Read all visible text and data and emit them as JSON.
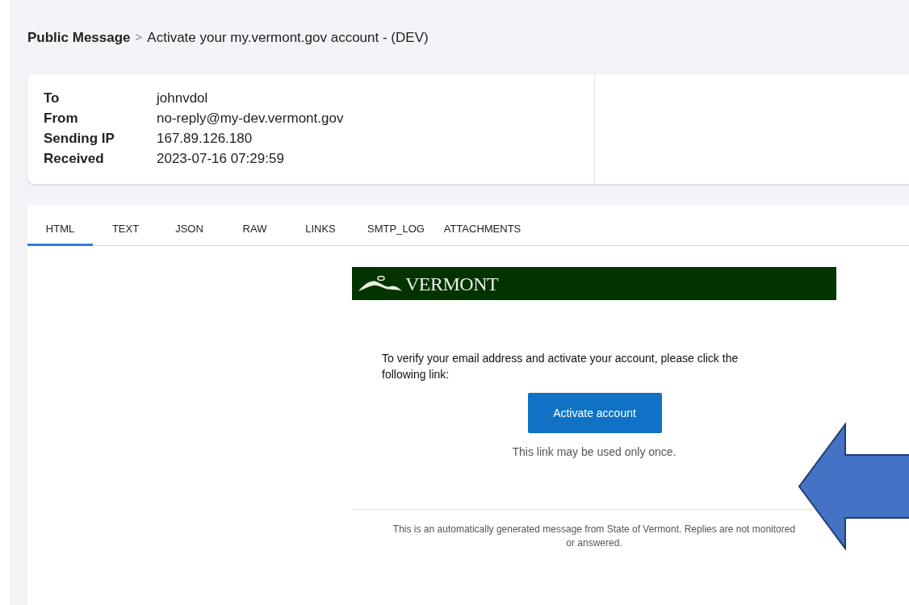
{
  "breadcrumb": {
    "root": "Public Message",
    "separator": ">",
    "current": "Activate your my.vermont.gov account - (DEV)"
  },
  "headers": [
    {
      "label": "To",
      "value": "johnvdol"
    },
    {
      "label": "From",
      "value": "no-reply@my-dev.vermont.gov"
    },
    {
      "label": "Sending IP",
      "value": "167.89.126.180"
    },
    {
      "label": "Received",
      "value": "2023-07-16 07:29:59"
    }
  ],
  "tabs": [
    {
      "label": "HTML",
      "selected": true
    },
    {
      "label": "TEXT",
      "selected": false
    },
    {
      "label": "JSON",
      "selected": false
    },
    {
      "label": "RAW",
      "selected": false
    },
    {
      "label": "LINKS",
      "selected": false
    },
    {
      "label": "SMTP_LOG",
      "selected": false
    },
    {
      "label": "ATTACHMENTS",
      "selected": false
    }
  ],
  "email": {
    "banner_title": "VERMONT",
    "body": "To verify your email address and activate your account, please click the following link:",
    "button": "Activate account",
    "note": "This link may be used only once.",
    "footer": "This is an automatically generated message from State of Vermont. Replies are not monitored or answered."
  }
}
